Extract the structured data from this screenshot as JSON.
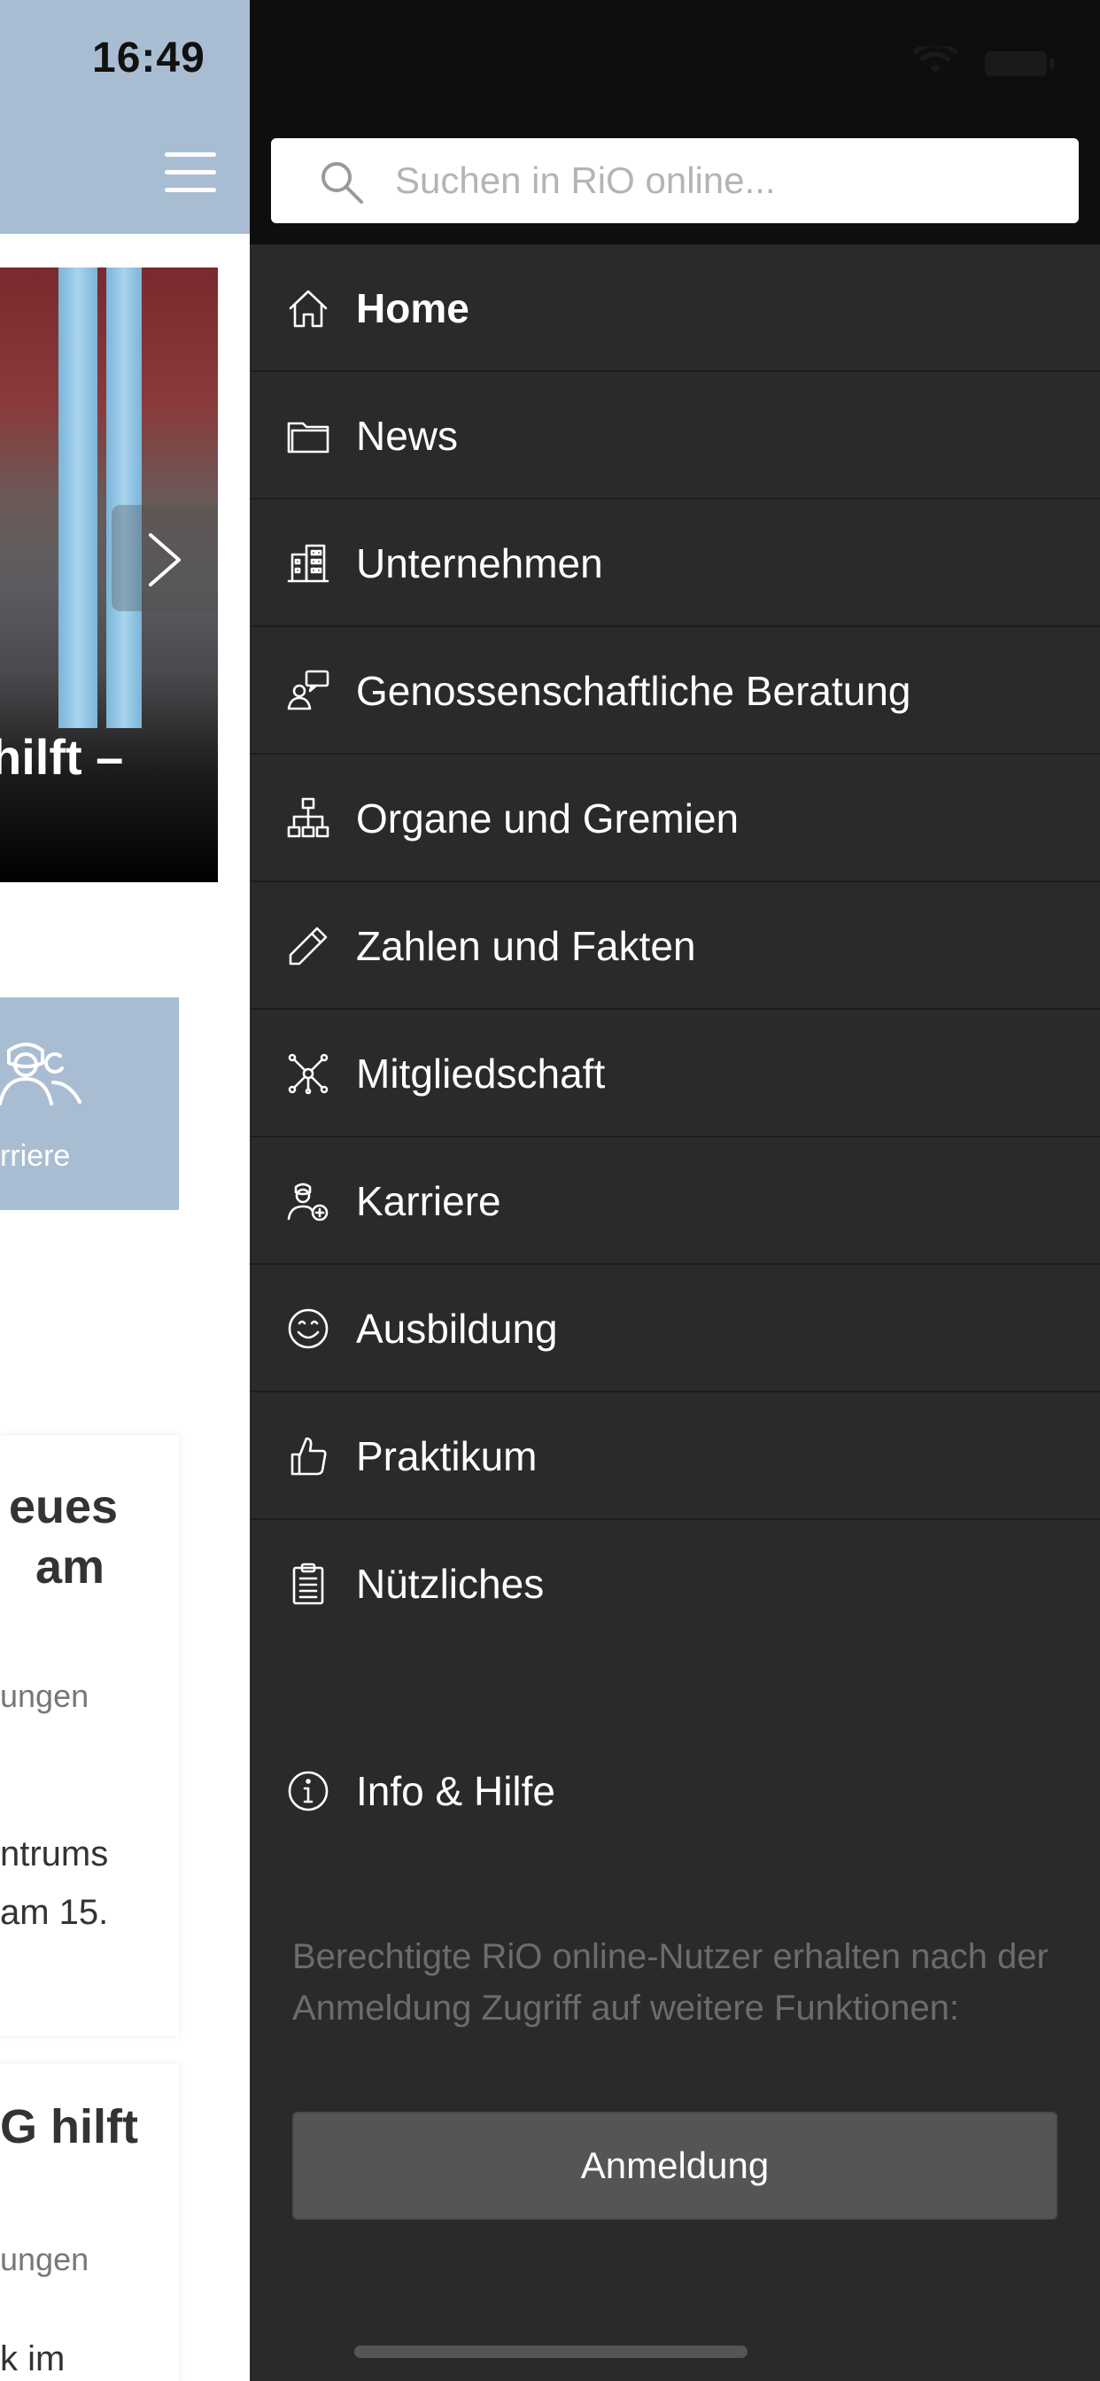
{
  "status_bar": {
    "time": "16:49"
  },
  "underlay": {
    "hero": {
      "caption": "hilft –"
    },
    "career_tile": {
      "label": "rriere"
    },
    "cards": [
      {
        "title_lines": [
          "eues",
          "am"
        ],
        "meta": "ungen",
        "body_lines": [
          "ntrums",
          "am 15."
        ]
      },
      {
        "title_lines": [
          "G hilft"
        ],
        "meta": "ungen",
        "body_lines": [
          "k im"
        ]
      }
    ]
  },
  "drawer": {
    "search": {
      "placeholder": "Suchen in RiO online..."
    },
    "menu": [
      {
        "label": "Home",
        "icon": "home-icon",
        "active": true
      },
      {
        "label": "News",
        "icon": "folder-icon"
      },
      {
        "label": "Unternehmen",
        "icon": "building-icon"
      },
      {
        "label": "Genossenschaftliche Beratung",
        "icon": "consulting-icon"
      },
      {
        "label": "Organe und Gremien",
        "icon": "org-chart-icon"
      },
      {
        "label": "Zahlen und Fakten",
        "icon": "pencil-icon"
      },
      {
        "label": "Mitgliedschaft",
        "icon": "network-icon"
      },
      {
        "label": "Karriere",
        "icon": "person-plus-icon"
      },
      {
        "label": "Ausbildung",
        "icon": "smiley-icon"
      },
      {
        "label": "Praktikum",
        "icon": "thumbs-up-icon"
      },
      {
        "label": "Nützliches",
        "icon": "clipboard-icon"
      }
    ],
    "info": {
      "label": "Info & Hilfe",
      "icon": "info-icon"
    },
    "login_note": "Berechtigte RiO online-Nutzer erhalten nach der Anmeldung Zugriff auf weitere Funktionen:",
    "login_button": "Anmeldung"
  },
  "colors": {
    "drawer_bg": "#2a2a2a",
    "header_blue": "#a9bdd2",
    "button_bg": "#555555"
  }
}
